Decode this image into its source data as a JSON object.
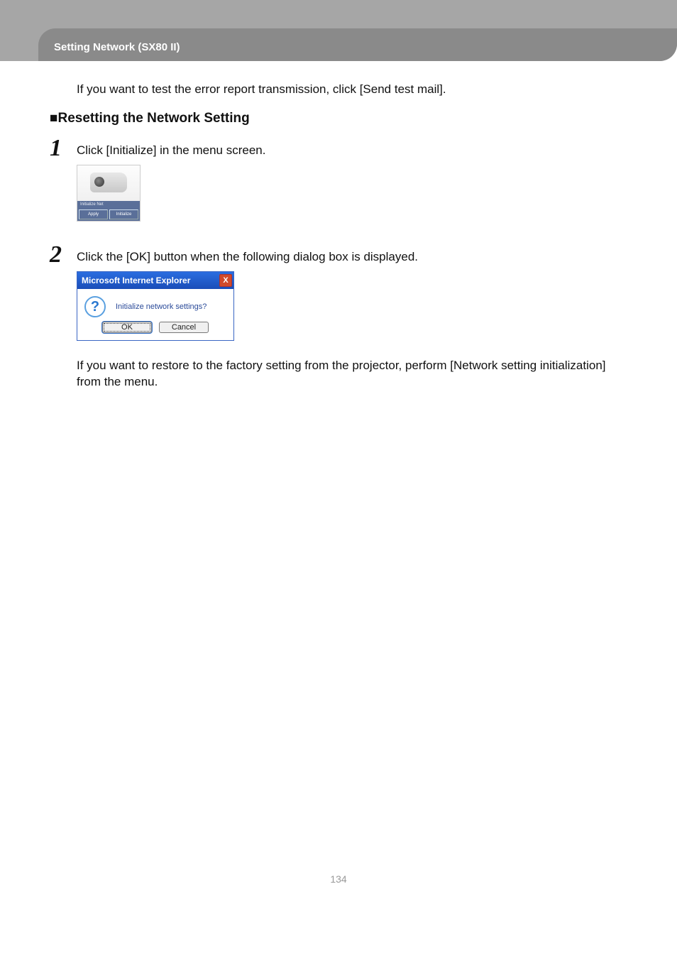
{
  "header": {
    "title": "Setting Network (SX80 II)"
  },
  "intro_text": "If you want to test the error report transmission, click [Send test mail].",
  "section_heading_bullet": "■",
  "section_heading": "Resetting the Network Setting",
  "steps": {
    "s1": {
      "num": "1",
      "text": "Click [Initialize] in the menu screen.",
      "projector_card": {
        "label": "Initialize Net",
        "apply": "Apply",
        "initialize": "Initialize"
      }
    },
    "s2": {
      "num": "2",
      "text": "Click the [OK] button when the following dialog box is displayed.",
      "dialog": {
        "title": "Microsoft Internet Explorer",
        "close": "X",
        "icon": "?",
        "message": "Initialize network settings?",
        "ok": "OK",
        "cancel": "Cancel"
      },
      "after_note": "If you want to restore to the factory setting from the projector, perform [Network setting initialization] from the menu."
    }
  },
  "page_number": "134"
}
